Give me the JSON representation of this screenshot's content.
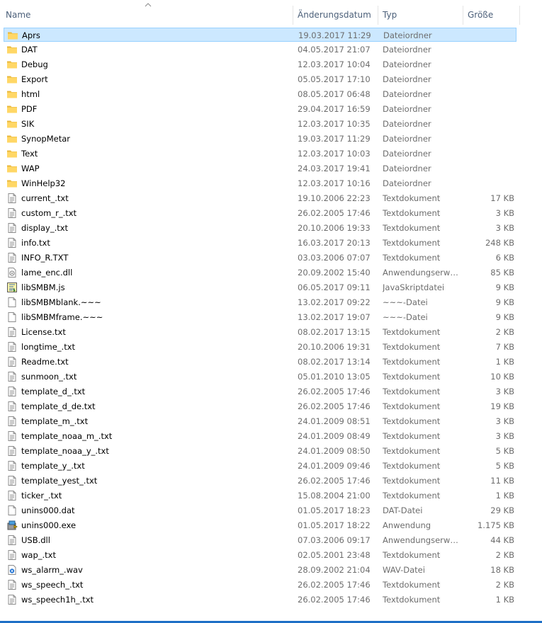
{
  "columns": {
    "name": "Name",
    "date": "Änderungsdatum",
    "type": "Typ",
    "size": "Größe"
  },
  "files": [
    {
      "name": "Aprs",
      "date": "19.03.2017 11:29",
      "type": "Dateiordner",
      "size": "",
      "icon": "folder-icon",
      "selected": true
    },
    {
      "name": "DAT",
      "date": "04.05.2017 21:07",
      "type": "Dateiordner",
      "size": "",
      "icon": "folder-icon"
    },
    {
      "name": "Debug",
      "date": "12.03.2017 10:04",
      "type": "Dateiordner",
      "size": "",
      "icon": "folder-icon"
    },
    {
      "name": "Export",
      "date": "05.05.2017 17:10",
      "type": "Dateiordner",
      "size": "",
      "icon": "folder-icon"
    },
    {
      "name": "html",
      "date": "08.05.2017 06:48",
      "type": "Dateiordner",
      "size": "",
      "icon": "folder-icon"
    },
    {
      "name": "PDF",
      "date": "29.04.2017 16:59",
      "type": "Dateiordner",
      "size": "",
      "icon": "folder-icon"
    },
    {
      "name": "SIK",
      "date": "12.03.2017 10:35",
      "type": "Dateiordner",
      "size": "",
      "icon": "folder-icon"
    },
    {
      "name": "SynopMetar",
      "date": "19.03.2017 11:29",
      "type": "Dateiordner",
      "size": "",
      "icon": "folder-icon"
    },
    {
      "name": "Text",
      "date": "12.03.2017 10:03",
      "type": "Dateiordner",
      "size": "",
      "icon": "folder-icon"
    },
    {
      "name": "WAP",
      "date": "24.03.2017 19:41",
      "type": "Dateiordner",
      "size": "",
      "icon": "folder-icon"
    },
    {
      "name": "WinHelp32",
      "date": "12.03.2017 10:16",
      "type": "Dateiordner",
      "size": "",
      "icon": "folder-icon"
    },
    {
      "name": "current_.txt",
      "date": "19.10.2006 22:23",
      "type": "Textdokument",
      "size": "17 KB",
      "icon": "text-file-icon"
    },
    {
      "name": "custom_r_.txt",
      "date": "26.02.2005 17:46",
      "type": "Textdokument",
      "size": "3 KB",
      "icon": "text-file-icon"
    },
    {
      "name": "display_.txt",
      "date": "20.10.2006 19:33",
      "type": "Textdokument",
      "size": "3 KB",
      "icon": "text-file-icon"
    },
    {
      "name": "info.txt",
      "date": "16.03.2017 20:13",
      "type": "Textdokument",
      "size": "248 KB",
      "icon": "text-file-icon"
    },
    {
      "name": "INFO_R.TXT",
      "date": "03.03.2006 07:07",
      "type": "Textdokument",
      "size": "6 KB",
      "icon": "text-file-icon"
    },
    {
      "name": "lame_enc.dll",
      "date": "20.09.2002 15:40",
      "type": "Anwendungserwe...",
      "size": "85 KB",
      "icon": "dll-file-icon"
    },
    {
      "name": "libSMBM.js",
      "date": "06.05.2017 09:11",
      "type": "JavaSkriptdatei",
      "size": "9 KB",
      "icon": "script-file-icon"
    },
    {
      "name": "libSMBMblank.~~~",
      "date": "13.02.2017 09:22",
      "type": "~~~-Datei",
      "size": "9 KB",
      "icon": "blank-file-icon"
    },
    {
      "name": "libSMBMframe.~~~",
      "date": "13.02.2017 19:07",
      "type": "~~~-Datei",
      "size": "9 KB",
      "icon": "blank-file-icon"
    },
    {
      "name": "License.txt",
      "date": "08.02.2017 13:15",
      "type": "Textdokument",
      "size": "2 KB",
      "icon": "text-file-icon"
    },
    {
      "name": "longtime_.txt",
      "date": "20.10.2006 19:31",
      "type": "Textdokument",
      "size": "7 KB",
      "icon": "text-file-icon"
    },
    {
      "name": "Readme.txt",
      "date": "08.02.2017 13:14",
      "type": "Textdokument",
      "size": "1 KB",
      "icon": "text-file-icon"
    },
    {
      "name": "sunmoon_.txt",
      "date": "05.01.2010 13:05",
      "type": "Textdokument",
      "size": "10 KB",
      "icon": "text-file-icon"
    },
    {
      "name": "template_d_.txt",
      "date": "26.02.2005 17:46",
      "type": "Textdokument",
      "size": "3 KB",
      "icon": "text-file-icon"
    },
    {
      "name": "template_d_de.txt",
      "date": "26.02.2005 17:46",
      "type": "Textdokument",
      "size": "19 KB",
      "icon": "text-file-icon"
    },
    {
      "name": "template_m_.txt",
      "date": "24.01.2009 08:51",
      "type": "Textdokument",
      "size": "3 KB",
      "icon": "text-file-icon"
    },
    {
      "name": "template_noaa_m_.txt",
      "date": "24.01.2009 08:49",
      "type": "Textdokument",
      "size": "3 KB",
      "icon": "text-file-icon"
    },
    {
      "name": "template_noaa_y_.txt",
      "date": "24.01.2009 08:50",
      "type": "Textdokument",
      "size": "5 KB",
      "icon": "text-file-icon"
    },
    {
      "name": "template_y_.txt",
      "date": "24.01.2009 09:46",
      "type": "Textdokument",
      "size": "5 KB",
      "icon": "text-file-icon"
    },
    {
      "name": "template_yest_.txt",
      "date": "26.02.2005 17:46",
      "type": "Textdokument",
      "size": "11 KB",
      "icon": "text-file-icon"
    },
    {
      "name": "ticker_.txt",
      "date": "15.08.2004 21:00",
      "type": "Textdokument",
      "size": "1 KB",
      "icon": "text-file-icon"
    },
    {
      "name": "unins000.dat",
      "date": "01.05.2017 18:23",
      "type": "DAT-Datei",
      "size": "29 KB",
      "icon": "blank-file-icon"
    },
    {
      "name": "unins000.exe",
      "date": "01.05.2017 18:22",
      "type": "Anwendung",
      "size": "1.175 KB",
      "icon": "uninstaller-icon"
    },
    {
      "name": "USB.dll",
      "date": "07.03.2006 09:17",
      "type": "Anwendungserwe...",
      "size": "44 KB",
      "icon": "text-file-icon"
    },
    {
      "name": "wap_.txt",
      "date": "02.05.2001 23:48",
      "type": "Textdokument",
      "size": "2 KB",
      "icon": "text-file-icon"
    },
    {
      "name": "ws_alarm_.wav",
      "date": "28.09.2002 21:04",
      "type": "WAV-Datei",
      "size": "18 KB",
      "icon": "audio-file-icon"
    },
    {
      "name": "ws_speech_.txt",
      "date": "26.02.2005 17:46",
      "type": "Textdokument",
      "size": "2 KB",
      "icon": "text-file-icon"
    },
    {
      "name": "ws_speech1h_.txt",
      "date": "26.02.2005 17:46",
      "type": "Textdokument",
      "size": "1 KB",
      "icon": "text-file-icon"
    }
  ],
  "colors": {
    "selection_bg": "#cce8ff",
    "selection_border": "#99d1ff",
    "header_text": "#4c607a",
    "folder": "#ffd766"
  }
}
